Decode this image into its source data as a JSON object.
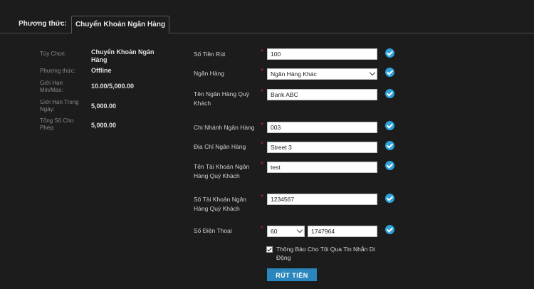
{
  "tabs": {
    "method": "Phương thức:",
    "bank_transfer": "Chuyển Khoản Ngân Hàng"
  },
  "summary": [
    {
      "label": "Tùy Chọn:",
      "value": "Chuyển Khoản Ngân Hàng"
    },
    {
      "label": "Phương thức:",
      "value": "Offline"
    },
    {
      "label": "Giới Hạn Min/Max:",
      "value": "10.00/5,000.00"
    },
    {
      "label": "Giới Hạn Trong Ngày:",
      "value": "5,000.00"
    },
    {
      "label": "Tổng Số Cho Phép:",
      "value": "5,000.00"
    }
  ],
  "form": {
    "amount": {
      "label": "Số Tiền Rút",
      "value": "100"
    },
    "bank": {
      "label": "Ngân Hàng",
      "value": "Ngân Hàng Khác"
    },
    "bank_name": {
      "label": "Tên Ngân Hàng Quý Khách",
      "value": "Bank ABC"
    },
    "branch": {
      "label": "Chi Nhánh Ngân Hàng",
      "value": "003"
    },
    "address": {
      "label": "Địa Chỉ Ngân Hàng",
      "value": "Street 3"
    },
    "account_name": {
      "label": "Tên Tài Khoản Ngân Hàng Quý Khách",
      "value": "test"
    },
    "account_number": {
      "label": "Số Tài Khoản Ngân Hàng Quý Khách",
      "value": "1234567"
    },
    "phone": {
      "label": "Số Điện Thoại",
      "code": "60",
      "value": "1747964"
    },
    "sms_notify": {
      "label": "Thông Báo Cho Tôi Qua Tin Nhắn Di Động",
      "checked": true
    },
    "submit_label": "RÚT TIỀN",
    "required_mark": "*"
  },
  "colors": {
    "background": "#1c1c1c",
    "accent": "#2ea2dd",
    "required": "#c8222a",
    "button": "#2a87bd"
  }
}
